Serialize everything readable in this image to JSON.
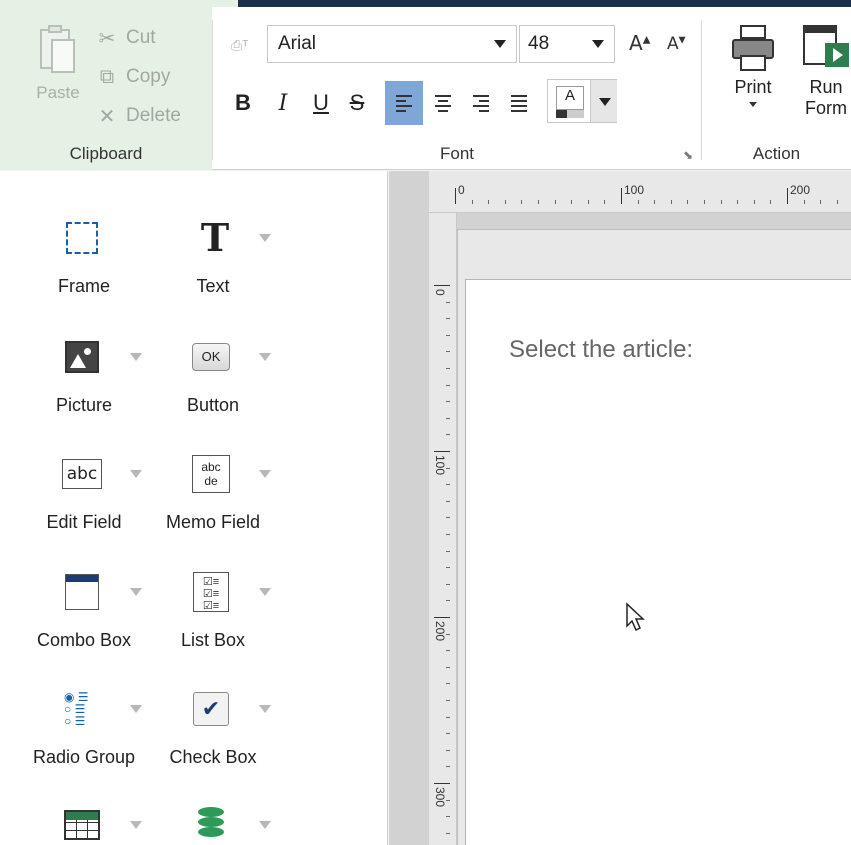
{
  "ribbon": {
    "clipboard": {
      "paste_label": "Paste",
      "cut_label": "Cut",
      "copy_label": "Copy",
      "delete_label": "Delete",
      "group_label": "Clipboard"
    },
    "font": {
      "family": "Arial",
      "size": "48",
      "grow_label": "A",
      "shrink_label": "A",
      "bold": "B",
      "italic": "I",
      "underline": "U",
      "strike": "S",
      "color_letter": "A",
      "group_label": "Font"
    },
    "action": {
      "print_label": "Print",
      "run_form_label_1": "Run",
      "run_form_label_2": "Form",
      "group_label": "Action"
    }
  },
  "toolbox": {
    "items": [
      {
        "label": "Frame",
        "icon": "frame-icon"
      },
      {
        "label": "Text",
        "icon": "text-icon"
      },
      {
        "label": "Picture",
        "icon": "picture-icon"
      },
      {
        "label": "Button",
        "icon": "button-icon",
        "icon_text": "OK"
      },
      {
        "label": "Edit Field",
        "icon": "edit-field-icon",
        "icon_text": "abc"
      },
      {
        "label": "Memo Field",
        "icon": "memo-field-icon",
        "icon_text_1": "abc",
        "icon_text_2": "de"
      },
      {
        "label": "Combo Box",
        "icon": "combo-box-icon"
      },
      {
        "label": "List Box",
        "icon": "list-box-icon"
      },
      {
        "label": "Radio Group",
        "icon": "radio-group-icon"
      },
      {
        "label": "Check Box",
        "icon": "check-box-icon"
      },
      {
        "label": "",
        "icon": "grid-icon"
      },
      {
        "label": "",
        "icon": "database-navigator-icon"
      }
    ]
  },
  "design": {
    "ruler_h": [
      "0",
      "100",
      "200"
    ],
    "ruler_v": [
      "0",
      "100",
      "200",
      "300"
    ],
    "page_text": "Select the article:"
  },
  "colors": {
    "accent_blue": "#7ea6d6",
    "clipboard_bg": "#e6f1e6",
    "frame_blue": "#1c5ea8",
    "green": "#2e7d4f"
  }
}
